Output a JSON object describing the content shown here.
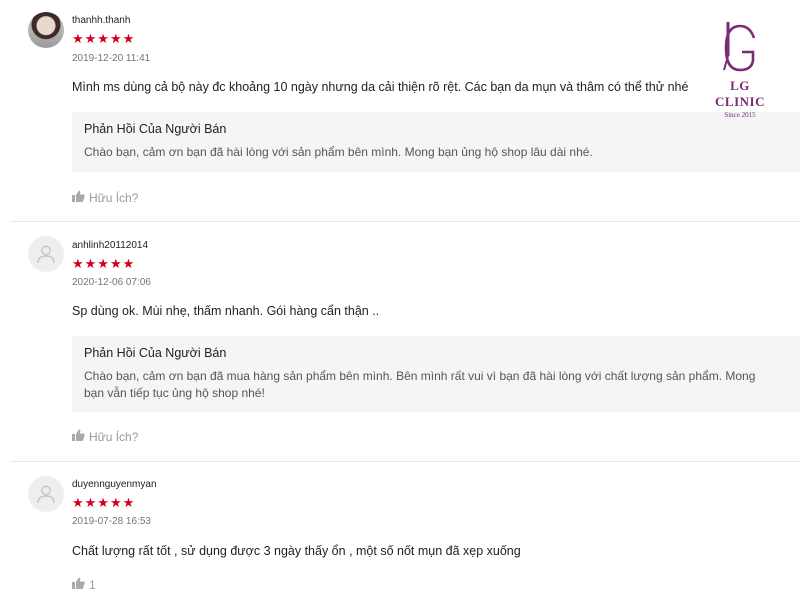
{
  "brand": {
    "name": "LG CLINIC",
    "since": "Since 2015",
    "color": "#7b2a74"
  },
  "colors": {
    "star": "#d0011b",
    "reply_bg": "#f5f5f5",
    "muted": "#999999"
  },
  "reviews": [
    {
      "username": "thanhh.thanh",
      "avatar": "user-photo",
      "stars": "★★★★★",
      "rating": 5,
      "date": "2019-12-20 11:41",
      "comment": "Mình ms dùng cả bộ này đc khoảng 10 ngày nhưng da cải thiện rõ rệt. Các bạn da mụn và thâm có thể thử nhé",
      "reply": {
        "title": "Phản Hồi Của Người Bán",
        "text": "Chào bạn, cảm ơn bạn đã hài lòng với sản phẩm bên mình. Mong bạn ủng hộ shop lâu dài nhé."
      },
      "helpful_label": "Hữu Ích?"
    },
    {
      "username": "anhlinh20112014",
      "avatar": "default-user-icon",
      "stars": "★★★★★",
      "rating": 5,
      "date": "2020-12-06 07:06",
      "comment": "Sp dùng ok. Mùi nhẹ, thấm nhanh. Gói hàng cẩn thận ..",
      "reply": {
        "title": "Phản Hồi Của Người Bán",
        "text_line1": "Chào bạn, cảm ơn bạn đã mua hàng sản phẩm bên mình. Bên mình rất vui vì bạn đã hài lòng với chất lượng sản phẩm. Mong",
        "text_line2": "bạn vẫn tiếp tục ủng hộ shop nhé!"
      },
      "helpful_label": "Hữu Ích?"
    },
    {
      "username": "duyennguyenmyan",
      "avatar": "default-user-icon",
      "stars": "★★★★★",
      "rating": 5,
      "date": "2019-07-28 16:53",
      "comment": "Chất lượng rất tốt , sử dụng được 3 ngày thấy ổn , một số nốt mụn đã xẹp xuống",
      "helpful_count": "1"
    }
  ]
}
